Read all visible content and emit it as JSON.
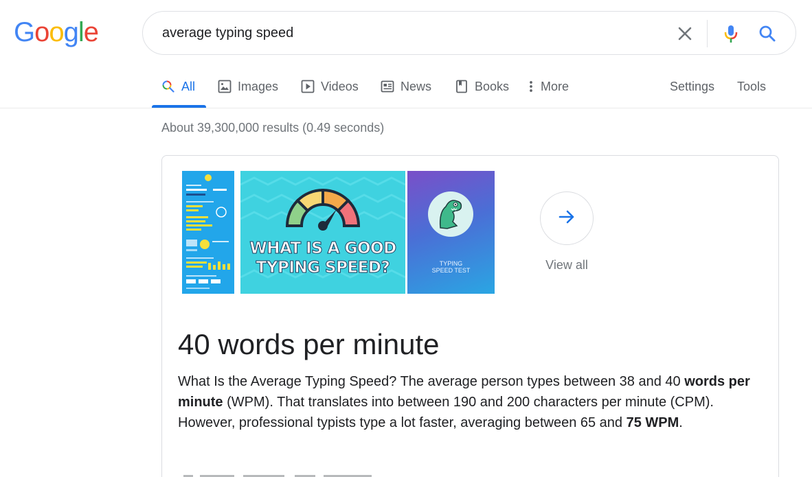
{
  "logo": {
    "letters": [
      "G",
      "o",
      "o",
      "g",
      "l",
      "e"
    ],
    "colors": [
      "#4285F4",
      "#EA4335",
      "#FBBC05",
      "#4285F4",
      "#34A853",
      "#EA4335"
    ]
  },
  "search": {
    "query": "average typing speed",
    "icons": [
      "close-icon",
      "mic-icon",
      "search-icon"
    ]
  },
  "tabs": [
    {
      "label": "All",
      "icon": "search-icon",
      "active": true
    },
    {
      "label": "Images",
      "icon": "image-icon",
      "active": false
    },
    {
      "label": "Videos",
      "icon": "play-icon",
      "active": false
    },
    {
      "label": "News",
      "icon": "newspaper-icon",
      "active": false
    },
    {
      "label": "Books",
      "icon": "book-icon",
      "active": false
    },
    {
      "label": "More",
      "icon": "more-vert-icon",
      "active": false
    }
  ],
  "tools": {
    "settings_label": "Settings",
    "tools_label": "Tools"
  },
  "result_stats": "About 39,300,000 results (0.49 seconds)",
  "featured": {
    "images": {
      "thumb2_line1": "WHAT IS A GOOD",
      "thumb2_line2": "TYPING SPEED?",
      "thumb3_line1": "TYPING",
      "thumb3_line2": "SPEED TEST"
    },
    "view_all_label": "View all",
    "answer": "40 words per minute",
    "snippet": {
      "part1": "What Is the Average Typing Speed? The average person types between 38 and 40 ",
      "bold1": "words per minute",
      "part2": " (WPM). That translates into between 190 and 200 characters per minute (CPM). However, professional typists type a lot faster, averaging between 65 and ",
      "bold2": "75 WPM",
      "part3": "."
    }
  },
  "colors": {
    "accent": "#1a73e8",
    "muted_text": "#70757a",
    "tab_text": "#5f6368",
    "border": "#dadce0"
  }
}
